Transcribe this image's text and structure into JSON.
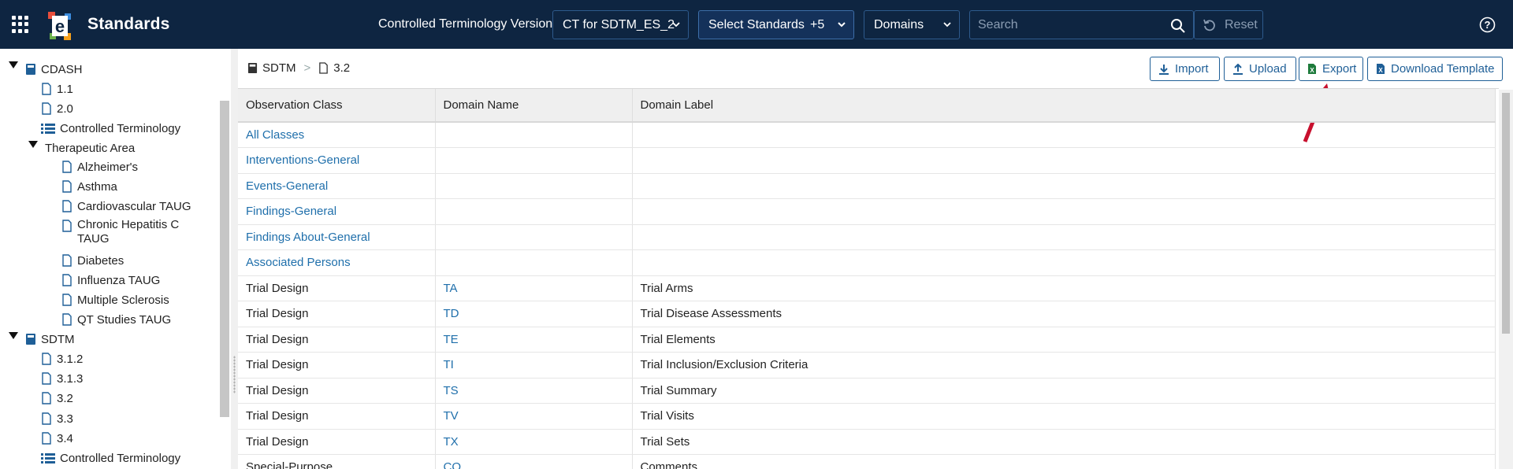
{
  "app": {
    "title": "Standards"
  },
  "topbar": {
    "ct_label": "Controlled Terminology Version",
    "ct_value": "CT for SDTM_ES_2",
    "standards_label": "Select Standards",
    "standards_count": "+5",
    "domains_label": "Domains",
    "search_placeholder": "Search",
    "reset_label": "Reset"
  },
  "sidebar": {
    "cdash": {
      "label": "CDASH",
      "items": [
        "1.1",
        "2.0"
      ],
      "ct": "Controlled Terminology"
    },
    "therapeutic": {
      "label": "Therapeutic Area",
      "items": [
        "Alzheimer's",
        "Asthma",
        "Cardiovascular TAUG",
        "Chronic Hepatitis C TAUG",
        "Diabetes",
        "Influenza TAUG",
        "Multiple Sclerosis",
        "QT Studies TAUG"
      ]
    },
    "sdtm": {
      "label": "SDTM",
      "items": [
        "3.1.2",
        "3.1.3",
        "3.2",
        "3.3",
        "3.4"
      ],
      "ct": "Controlled Terminology"
    }
  },
  "breadcrumb": {
    "root": "SDTM",
    "current": "3.2"
  },
  "actions": {
    "import": "Import",
    "upload": "Upload",
    "export": "Export",
    "template": "Download Template"
  },
  "table": {
    "headers": [
      "Observation Class",
      "Domain Name",
      "Domain Label"
    ],
    "rows": [
      [
        "All Classes",
        "",
        ""
      ],
      [
        "Interventions-General",
        "",
        ""
      ],
      [
        "Events-General",
        "",
        ""
      ],
      [
        "Findings-General",
        "",
        ""
      ],
      [
        "Findings About-General",
        "",
        ""
      ],
      [
        "Associated Persons",
        "",
        ""
      ],
      [
        "Trial Design",
        "TA",
        "Trial Arms"
      ],
      [
        "Trial Design",
        "TD",
        "Trial Disease Assessments"
      ],
      [
        "Trial Design",
        "TE",
        "Trial Elements"
      ],
      [
        "Trial Design",
        "TI",
        "Trial Inclusion/Exclusion Criteria"
      ],
      [
        "Trial Design",
        "TS",
        "Trial Summary"
      ],
      [
        "Trial Design",
        "TV",
        "Trial Visits"
      ],
      [
        "Trial Design",
        "TX",
        "Trial Sets"
      ],
      [
        "Special-Purpose",
        "CO",
        "Comments"
      ]
    ]
  },
  "colors": {
    "topbar": "#0e2541",
    "link": "#1f6fab",
    "export_arrow": "#c8102e"
  }
}
